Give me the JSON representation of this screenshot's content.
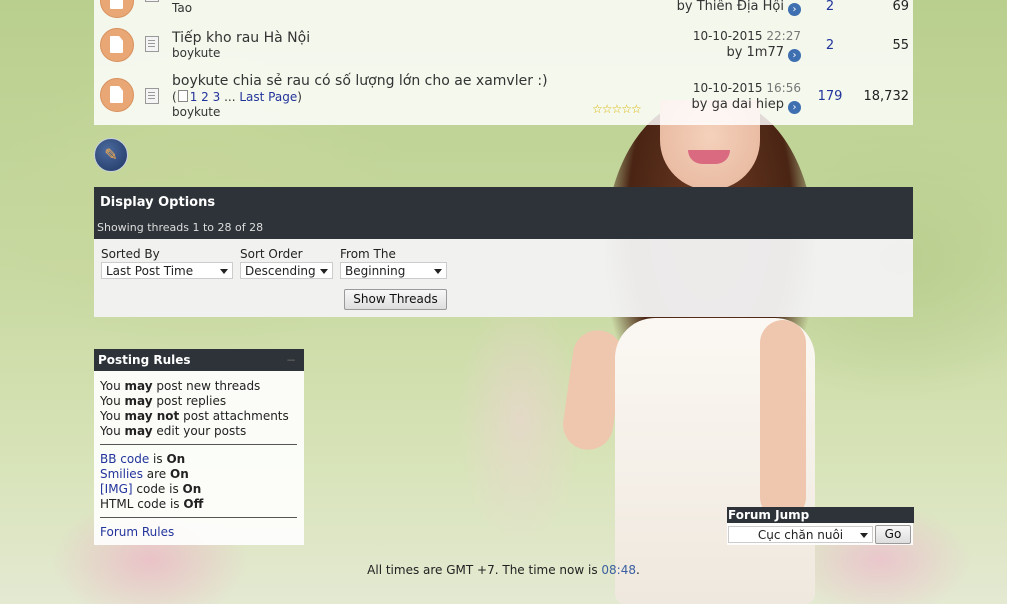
{
  "threads": [
    {
      "title": "",
      "author": "Tao",
      "last_time": "",
      "last_date": "",
      "last_by": "by Thiên Địa Hội",
      "replies": "2",
      "views": "69"
    },
    {
      "title": "Tiếp kho rau Hà Nội",
      "author": "boykute",
      "last_date": "10-10-2015",
      "last_time": "22:27",
      "last_by": "by 1m77",
      "replies": "2",
      "views": "55"
    },
    {
      "title": "boykute chia sẻ rau có số lượng lớn cho ae xamvler :)",
      "author": "boykute",
      "pages": [
        "1",
        "2",
        "3"
      ],
      "pages_ellipsis": "...",
      "last_page": "Last Page",
      "rating_stars": "☆☆☆☆☆",
      "last_date": "10-10-2015",
      "last_time": "16:56",
      "last_by": "by ga dai hiep",
      "replies": "179",
      "views": "18,732"
    }
  ],
  "icons": {
    "new_thread": "pencil-icon",
    "go_last_post": "arrow-right-circle-icon",
    "thread_status": "thread-status-icon",
    "thread_type": "document-icon"
  },
  "display_options": {
    "title": "Display Options",
    "subtitle": "Showing threads 1 to 28 of 28",
    "sorted_by_label": "Sorted By",
    "sorted_by_value": "Last Post Time",
    "sort_order_label": "Sort Order",
    "sort_order_value": "Descending",
    "from_label": "From The",
    "from_value": "Beginning",
    "submit": "Show Threads"
  },
  "posting_rules": {
    "title": "Posting Rules",
    "collapse": "−",
    "rules": [
      {
        "pre": "You ",
        "strong": "may",
        "post": " post new threads"
      },
      {
        "pre": "You ",
        "strong": "may",
        "post": " post replies"
      },
      {
        "pre": "You ",
        "strong": "may not",
        "post": " post attachments"
      },
      {
        "pre": "You ",
        "strong": "may",
        "post": " edit your posts"
      }
    ],
    "codes": [
      {
        "link": "BB code",
        "mid": " is ",
        "state": "On"
      },
      {
        "link": "Smilies",
        "mid": " are ",
        "state": "On"
      },
      {
        "link": "[IMG]",
        "mid": " code is ",
        "state": "On"
      },
      {
        "link": "",
        "mid": "HTML code is ",
        "state": "Off"
      }
    ],
    "forum_rules": "Forum Rules"
  },
  "forum_jump": {
    "title": "Forum Jump",
    "value": "Cục chăn nuôi",
    "go": "Go"
  },
  "footer": {
    "prefix": "All times are GMT +7. The time now is ",
    "time": "08:48",
    "suffix": "."
  },
  "colors": {
    "header_dark": "#2d3338",
    "link_blue": "#22349c",
    "accent_orange": "#e9a775"
  }
}
